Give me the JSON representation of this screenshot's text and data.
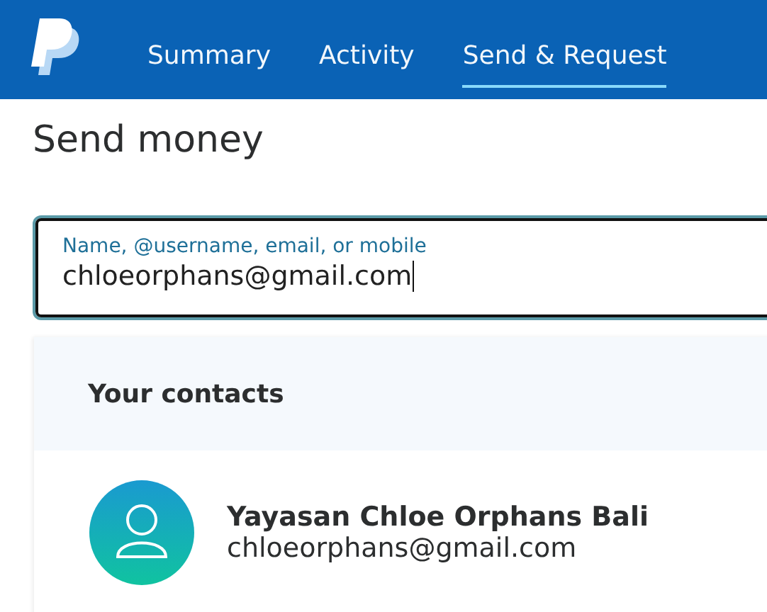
{
  "nav": {
    "tabs": [
      {
        "label": "Summary",
        "selected": false
      },
      {
        "label": "Activity",
        "selected": false
      },
      {
        "label": "Send & Request",
        "selected": true
      }
    ]
  },
  "page_title": "Send money",
  "recipient_field": {
    "label": "Name, @username, email, or mobile",
    "value": "chloeorphans@gmail.com"
  },
  "contacts": {
    "title": "Your contacts",
    "items": [
      {
        "name": "Yayasan Chloe Orphans Bali",
        "email": "chloeorphans@gmail.com"
      }
    ]
  }
}
